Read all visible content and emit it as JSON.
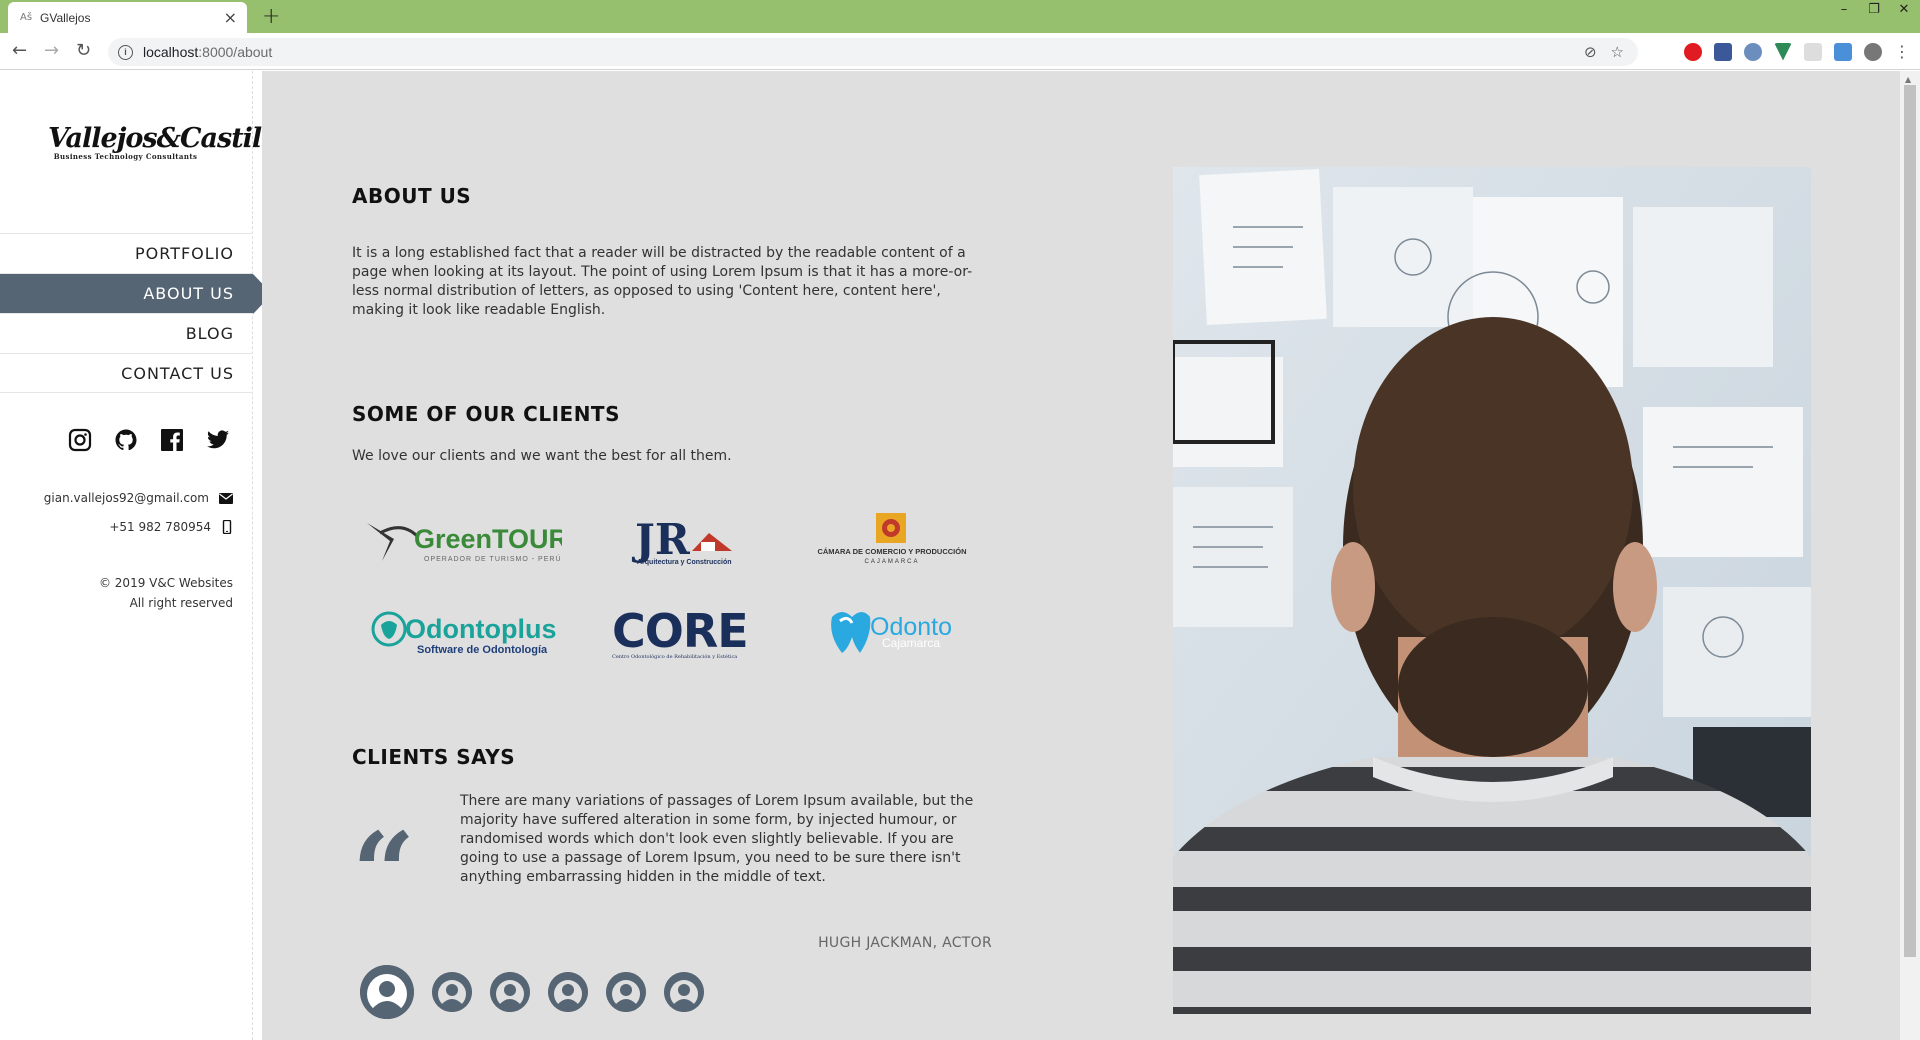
{
  "browser": {
    "tab_title": "GVallejos",
    "tab_favicon": "Aš",
    "url_host": "localhost",
    "url_path": ":8000/about"
  },
  "sidebar": {
    "logo_script": "Vallejos&Castillo",
    "logo_sub": "Business Technology Consultants",
    "nav": [
      {
        "label": "PORTFOLIO",
        "active": false
      },
      {
        "label": "ABOUT US",
        "active": true
      },
      {
        "label": "BLOG",
        "active": false
      },
      {
        "label": "CONTACT US",
        "active": false
      }
    ],
    "socials": [
      "instagram-icon",
      "github-icon",
      "facebook-icon",
      "twitter-icon"
    ],
    "email": "gian.vallejos92@gmail.com",
    "phone": "+51 982 780954",
    "copyright_line1": "© 2019 V&C Websites",
    "copyright_line2": "All right reserved"
  },
  "about": {
    "title": "ABOUT US",
    "text": "It is a long established fact that a reader will be distracted by the readable content of a page when looking at its layout. The point of using Lorem Ipsum is that it has a more-or-less normal distribution of letters, as opposed to using 'Content here, content here', making it look like readable English."
  },
  "clients": {
    "title": "SOME OF OUR CLIENTS",
    "text": "We love our clients and we want the best for all them.",
    "logos": [
      {
        "name": "GreenTOURS",
        "sub": "OPERADOR DE TURISMO - PERÚ"
      },
      {
        "name": "JR",
        "sub": "Arquitectura y Construcción"
      },
      {
        "name": "CÁMARA DE COMERCIO Y PRODUCCIÓN",
        "sub": "CAJAMARCA"
      },
      {
        "name": "Odontoplus",
        "sub": "Software de Odontología"
      },
      {
        "name": "CORE",
        "sub": "Centro Odontológico de Rehabilitación y Estética"
      },
      {
        "name": "Odonto",
        "sub": "Cajamarca"
      }
    ]
  },
  "testimonials": {
    "title": "CLIENTS SAYS",
    "quote": "There are many variations of passages of Lorem Ipsum available, but the majority have suffered alteration in some form, by injected humour, or randomised words which don't look even slightly believable. If you are going to use a passage of Lorem Ipsum, you need to be sure there isn't anything embarrassing hidden in the middle of text.",
    "author": "HUGH JACKMAN, ACTOR",
    "avatar_count": 6
  },
  "colors": {
    "accent": "#566573",
    "page_bg": "#dfdfdf",
    "tabbar": "#96c06e"
  }
}
